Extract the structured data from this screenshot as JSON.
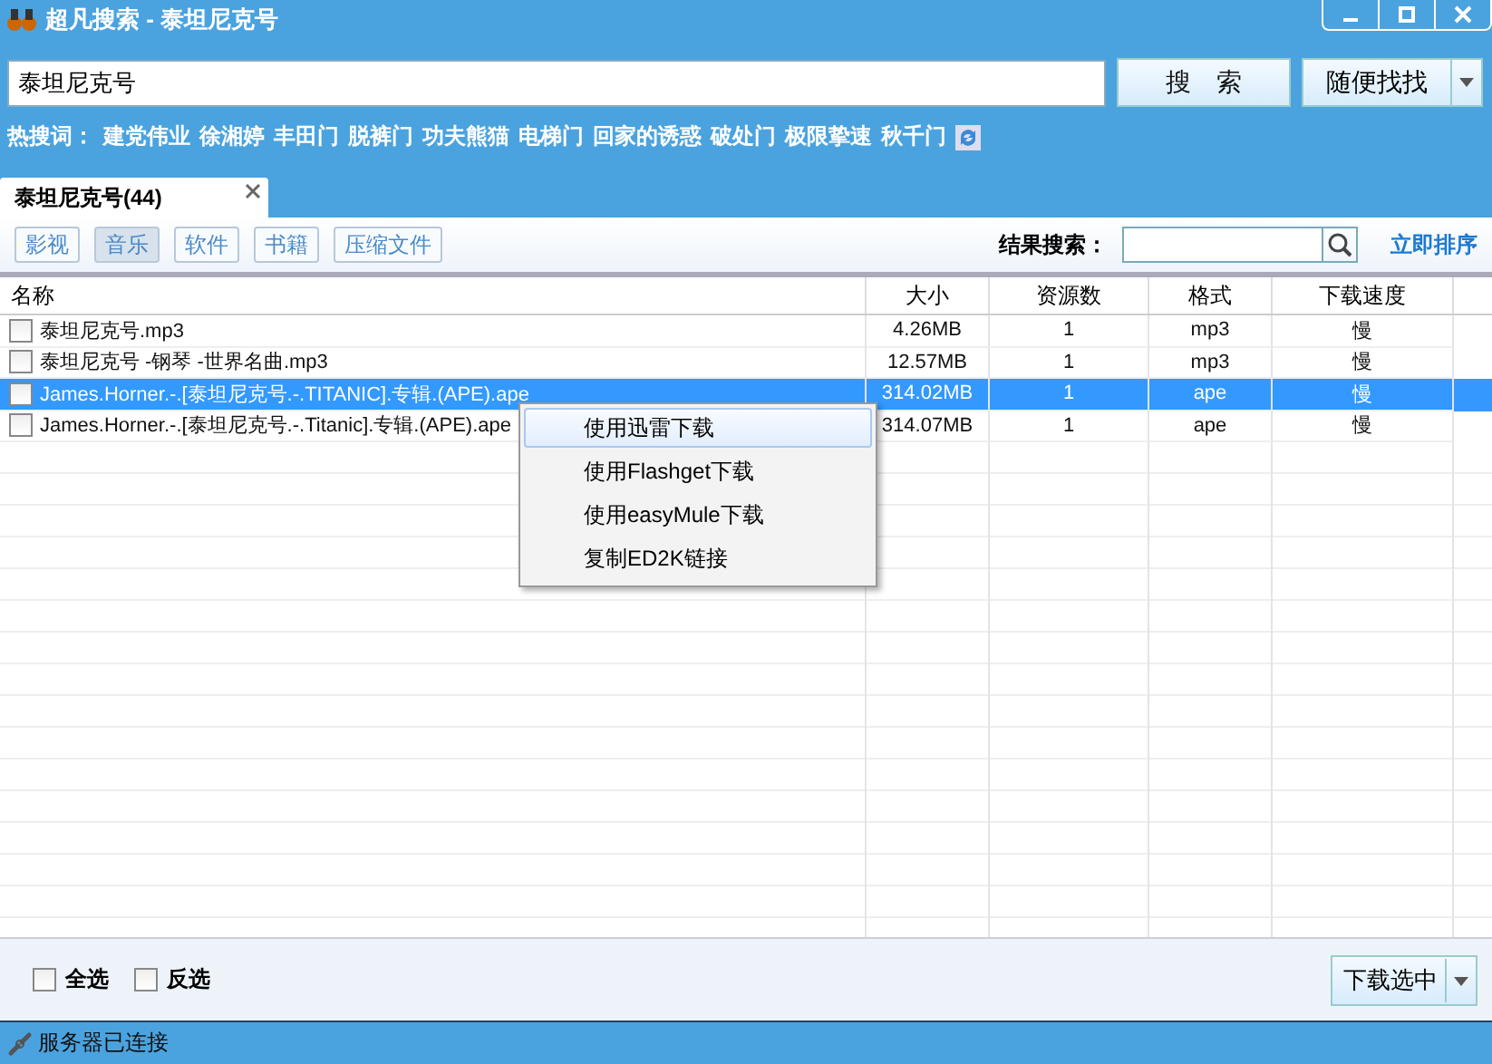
{
  "window": {
    "title": "超凡搜索 - 泰坦尼克号"
  },
  "search": {
    "value": "泰坦尼克号",
    "button": "搜　索",
    "random_button": "随便找找"
  },
  "hot_words": {
    "label": "热搜词：",
    "words": [
      "建党伟业",
      "徐湘婷",
      "丰田门",
      "脱裤门",
      "功夫熊猫",
      "电梯门",
      "回家的诱惑",
      "破处门",
      "极限挚速",
      "秋千门"
    ]
  },
  "tabs": [
    {
      "label": "泰坦尼克号(44)",
      "selected": true
    }
  ],
  "filters": [
    {
      "label": "影视",
      "selected": false
    },
    {
      "label": "音乐",
      "selected": true
    },
    {
      "label": "软件",
      "selected": false
    },
    {
      "label": "书籍",
      "selected": false
    },
    {
      "label": "压缩文件",
      "selected": false
    }
  ],
  "result_search": {
    "label": "结果搜索："
  },
  "sort_link": "立即排序",
  "table": {
    "columns": [
      "名称",
      "大小",
      "资源数",
      "格式",
      "下载速度"
    ],
    "rows": [
      {
        "checked": false,
        "selected": false,
        "cells": [
          "泰坦尼克号.mp3",
          "4.26MB",
          "1",
          "mp3",
          "慢"
        ]
      },
      {
        "checked": false,
        "selected": false,
        "cells": [
          "泰坦尼克号 -钢琴 -世界名曲.mp3",
          "12.57MB",
          "1",
          "mp3",
          "慢"
        ]
      },
      {
        "checked": false,
        "selected": true,
        "cells": [
          "James.Horner.-.[泰坦尼克号.-.TITANIC].专辑.(APE).ape",
          "314.02MB",
          "1",
          "ape",
          "慢"
        ]
      },
      {
        "checked": false,
        "selected": false,
        "cells": [
          "James.Horner.-.[泰坦尼克号.-.Titanic].专辑.(APE).ape",
          "314.07MB",
          "1",
          "ape",
          "慢"
        ]
      }
    ]
  },
  "context_menu": [
    {
      "label": "使用迅雷下载",
      "selected": true
    },
    {
      "label": "使用Flashget下载",
      "selected": false
    },
    {
      "label": "使用easyMule下载",
      "selected": false
    },
    {
      "label": "复制ED2K链接",
      "selected": false
    }
  ],
  "footer": {
    "options": [
      {
        "label": "全选",
        "checked": false
      },
      {
        "label": "反选",
        "checked": false
      }
    ],
    "download_button": "下载选中"
  },
  "status_bar": "服务器已连接"
}
